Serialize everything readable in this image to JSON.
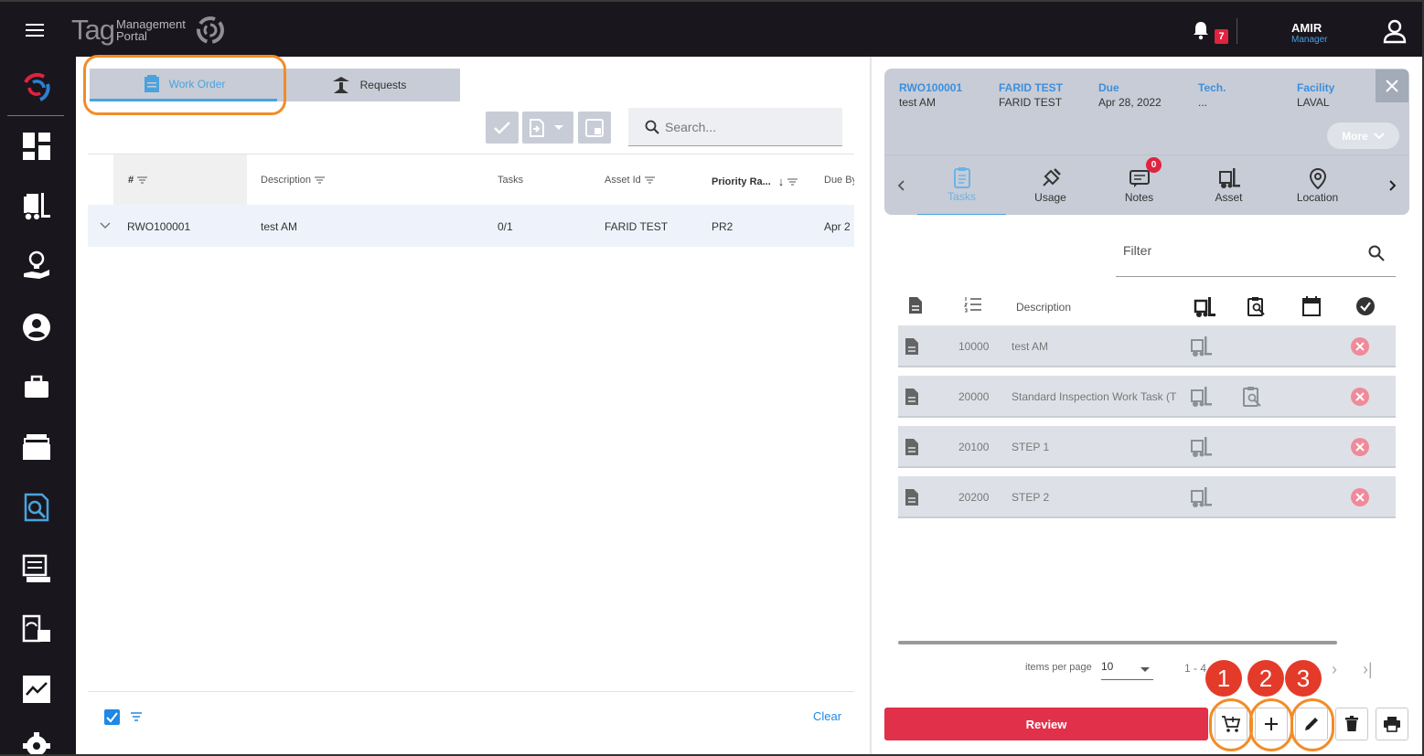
{
  "header": {
    "logo_main": "Tag",
    "logo_line1": "Management",
    "logo_line2": "Portal",
    "notification_count": "7",
    "user_name": "AMIR",
    "user_role": "Manager"
  },
  "sidebar": {
    "items": [
      {
        "icon": "tag-logo-icon",
        "active": true
      },
      {
        "icon": "dashboard-icon"
      },
      {
        "icon": "forklift-list-icon"
      },
      {
        "icon": "lightbulb-hand-icon"
      },
      {
        "icon": "account-circle-icon"
      },
      {
        "icon": "briefcase-icon"
      },
      {
        "icon": "folder-stack-icon"
      },
      {
        "icon": "inspection-search-icon"
      },
      {
        "icon": "receipt-list-icon"
      },
      {
        "icon": "gauge-report-icon"
      },
      {
        "icon": "trend-chart-icon"
      },
      {
        "icon": "settings-gear-icon"
      }
    ]
  },
  "left": {
    "tabs": [
      {
        "label": "Work Order",
        "active": true
      },
      {
        "label": "Requests",
        "active": false
      }
    ],
    "search": {
      "placeholder": "Search..."
    },
    "columns": [
      "#",
      "Description",
      "Tasks",
      "Asset Id",
      "Priority Ra...",
      "Due By"
    ],
    "rows": [
      {
        "id": "RWO100001",
        "description": "test AM",
        "tasks": "0/1",
        "asset_id": "FARID TEST",
        "priority": "PR2",
        "due_by": "Apr 2"
      }
    ],
    "footer": {
      "clear": "Clear"
    }
  },
  "detail": {
    "fields": [
      {
        "label": "RWO100001",
        "value": "test AM"
      },
      {
        "label": "FARID TEST",
        "value": "FARID TEST"
      },
      {
        "label": "Due",
        "value": "Apr 28, 2022"
      },
      {
        "label": "Tech.",
        "value": "..."
      },
      {
        "label": "Facility",
        "value": "LAVAL"
      }
    ],
    "more_label": "More",
    "tabs": [
      {
        "label": "Tasks",
        "icon": "clipboard-icon",
        "active": true
      },
      {
        "label": "Usage",
        "icon": "spark-plug-icon"
      },
      {
        "label": "Notes",
        "icon": "notes-icon",
        "badge": "0"
      },
      {
        "label": "Asset",
        "icon": "forklift-icon"
      },
      {
        "label": "Location",
        "icon": "location-pin-icon"
      }
    ],
    "filter": {
      "placeholder": "Filter"
    },
    "task_header": {
      "description": "Description"
    },
    "tasks": [
      {
        "num": "10000",
        "description": "test AM",
        "inspection": false
      },
      {
        "num": "20000",
        "description": "Standard Inspection Work Task (T",
        "inspection": true
      },
      {
        "num": "20100",
        "description": "STEP 1",
        "inspection": false
      },
      {
        "num": "20200",
        "description": "STEP 2",
        "inspection": false
      }
    ],
    "pagination": {
      "label": "items per page",
      "per_page": "10",
      "range": "1 - 4"
    },
    "review_label": "Review",
    "callouts": [
      "1",
      "2",
      "3"
    ]
  },
  "colors": {
    "topbar": "#19171d",
    "accent": "#4aa3df",
    "review": "#e0304a",
    "callout": "#e43a2a",
    "highlight_ring": "#f28c28"
  }
}
